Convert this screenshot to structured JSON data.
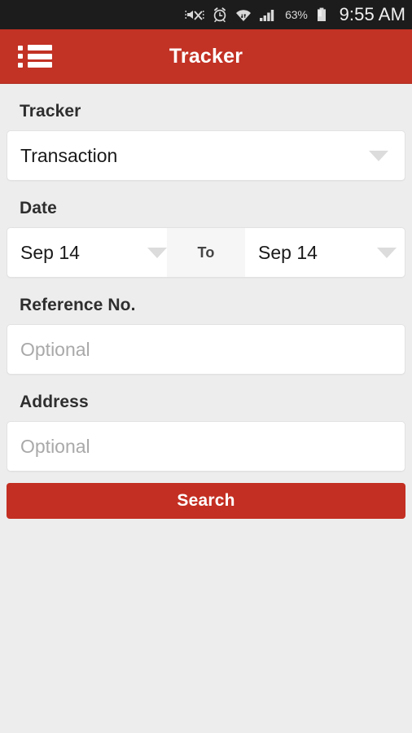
{
  "status_bar": {
    "icons": [
      "mute-vibrate-icon",
      "alarm-clock-icon",
      "wifi-icon",
      "signal-bars-icon"
    ],
    "battery_percent": "63%",
    "battery_icon": "battery-icon",
    "time": "9:55 AM"
  },
  "app_bar": {
    "menu_icon": "list-menu-icon",
    "title": "Tracker",
    "background_color": "#c23225"
  },
  "form": {
    "tracker": {
      "label": "Tracker",
      "value": "Transaction",
      "dropdown_icon": "chevron-down-icon"
    },
    "date": {
      "label": "Date",
      "from_value": "Sep 14",
      "separator": "To",
      "to_value": "Sep 14",
      "dropdown_icon": "chevron-down-icon"
    },
    "reference_no": {
      "label": "Reference No.",
      "value": "",
      "placeholder": "Optional"
    },
    "address": {
      "label": "Address",
      "value": "",
      "placeholder": "Optional"
    },
    "search_button": {
      "label": "Search",
      "background_color": "#c32f22"
    }
  }
}
